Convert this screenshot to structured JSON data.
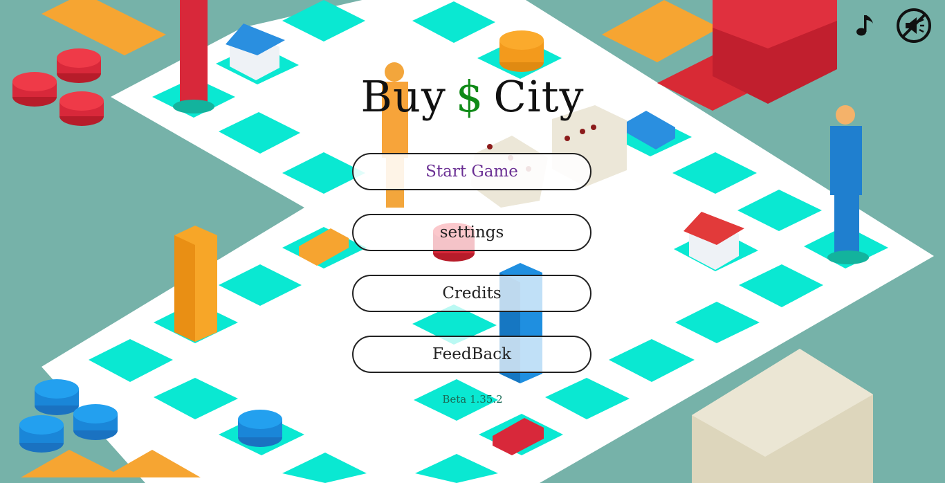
{
  "title": {
    "part1": "Buy",
    "symbol": "$",
    "part2": "City"
  },
  "menu": {
    "start": "Start Game",
    "settings": "settings",
    "credits": "Credits",
    "feedback": "FeedBack"
  },
  "version": "Beta 1.35.2",
  "icons": {
    "music": "music-note-icon",
    "mute": "mute-icon"
  },
  "colors": {
    "background": "#76b2a9",
    "board": "#ffffff",
    "tile": "#0fe8d0",
    "dollar": "#0f8a17",
    "start_text": "#6a2f93"
  }
}
